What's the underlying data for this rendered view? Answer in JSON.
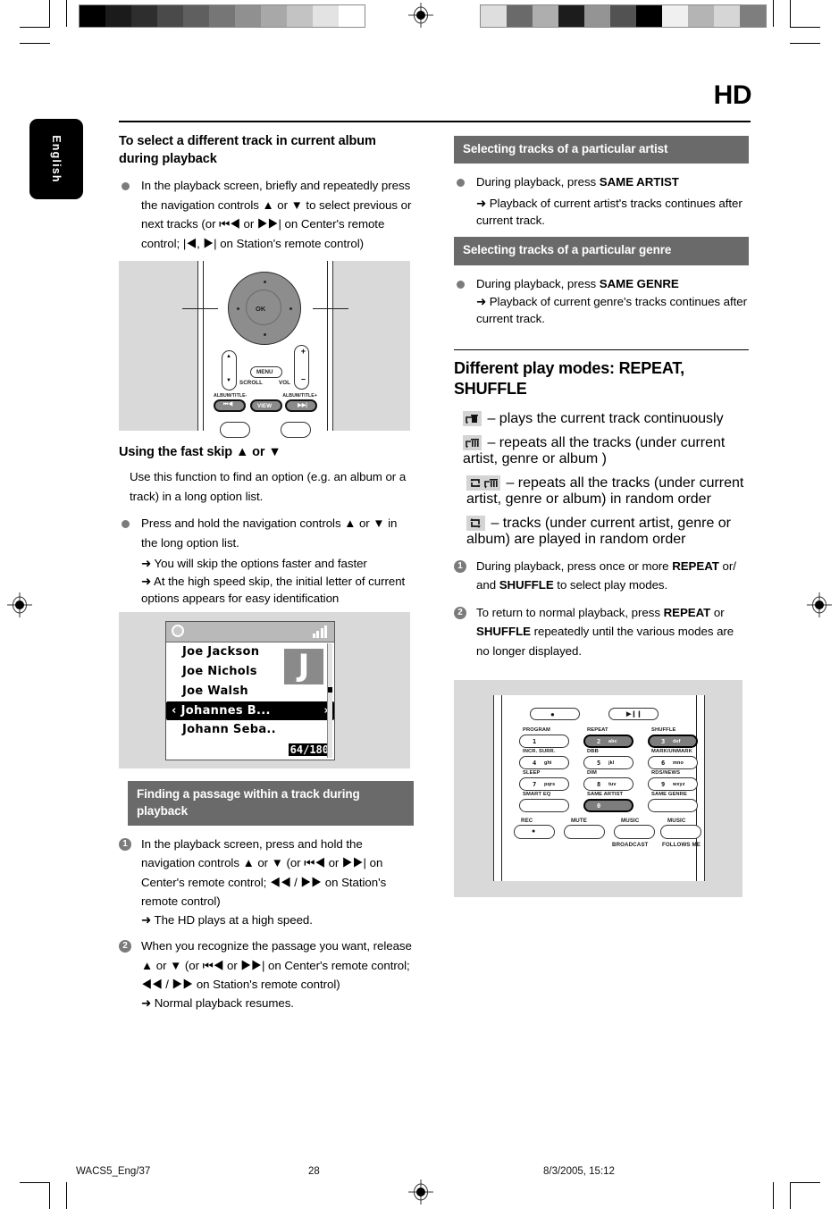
{
  "page": {
    "section_title": "HD",
    "language_tab": "English",
    "footer": {
      "file": "WACS5_Eng/37",
      "page_number": "28",
      "timestamp": "8/3/2005, 15:12"
    }
  },
  "calibration": {
    "left_strip": [
      "#000000",
      "#1b1b1b",
      "#2e2e2e",
      "#4a4a4a",
      "#5f5f5f",
      "#767676",
      "#909090",
      "#a8a8a8",
      "#c3c3c3",
      "#e3e3e3",
      "#ffffff"
    ],
    "right_strip": [
      "#dedede",
      "#6a6a6a",
      "#aeaeae",
      "#1c1c1c",
      "#949494",
      "#525252",
      "#000000",
      "#f0f0f0",
      "#b4b4b4",
      "#d6d6d6",
      "#7e7e7e"
    ]
  },
  "left_column": {
    "heading": "To select a different track in current album during playback",
    "bullet_1": "In the playback screen, briefly and repeatedly press the navigation controls ▲ or ▼ to select previous or next tracks (or ⏮◀ or ▶▶| on Center's remote control; |◀, ▶| on Station's remote control)",
    "figure_remote_1": {
      "name": "center-remote-navigation",
      "ok_label": "OK",
      "menu_label": "MENU",
      "view_label": "VIEW",
      "scroll_label": "SCROLL",
      "vol_label": "VOL",
      "vol_plus": "+",
      "vol_minus": "–",
      "album_prev": "ALBUM/TITLE-",
      "album_next": "ALBUM/TITLE+"
    },
    "fast_skip_heading": "Using the fast skip ▲ or ▼",
    "fast_skip_body": "Use this function to find an option (e.g. an album or a track) in a long option list.",
    "bullet_2": "Press and hold the navigation controls ▲ or ▼ in the long option list.",
    "bullet_2_arrow_1": "➜ You will skip the options faster and faster",
    "bullet_2_arrow_2": "➜  At the high speed skip, the initial letter of current options appears for easy identification",
    "figure_lcd": {
      "name": "artist-list-screen",
      "items": [
        "Joe  Jackson",
        "Joe Nichols",
        "Joe Walsh",
        "Johannes B...",
        "Johann Seba.."
      ],
      "selected_index": 3,
      "selected_left_arrow": "‹",
      "selected_right_arrow": "›",
      "initial_letter": "J",
      "counter": "64/180"
    },
    "bar_heading": "Finding a passage within a track during playback",
    "step_1": {
      "number": "1",
      "text": "In the playback screen, press and hold the navigation controls ▲ or ▼ (or ⏮◀ or ▶▶| on Center's remote control; ◀◀ / ▶▶ on Station's remote control)",
      "arrow": "➜ The HD plays at a high speed."
    },
    "step_2": {
      "number": "2",
      "text": "When you recognize the passage you want, release ▲ or ▼ (or ⏮◀ or ▶▶| on Center's remote control; ◀◀ / ▶▶ on Station's remote control)",
      "arrow": "➜ Normal playback resumes."
    }
  },
  "right_column": {
    "bar_heading_artist": "Selecting tracks of a particular artist",
    "artist_bullet": "During playback, press ",
    "artist_bullet_bold": "SAME ARTIST",
    "artist_arrow": "➜ Playback of current artist's tracks continues after current track.",
    "bar_heading_genre": "Selecting tracks of a particular genre",
    "genre_bullet": "During playback, press ",
    "genre_bullet_bold": "SAME GENRE",
    "genre_arrow": "➜ Playback of current genre's tracks continues after current track.",
    "play_modes_heading": "Different play modes: REPEAT, SHUFFLE",
    "modes": [
      {
        "icon": "repeat-one-icon",
        "text": "– plays the current track continuously"
      },
      {
        "icon": "repeat-all-icon",
        "text": "– repeats all the tracks (under current artist, genre or album )"
      },
      {
        "icon": "shuffle-repeat-all-icon",
        "text": "– repeats all the tracks (under current artist, genre or album) in random order"
      },
      {
        "icon": "shuffle-icon",
        "text": "– tracks (under current artist, genre or album) are played in random order"
      }
    ],
    "step_1": {
      "number": "1",
      "text_a": "During playback, press once or more ",
      "bold_a": "REPEAT",
      "text_b": " or/ and ",
      "bold_b": "SHUFFLE",
      "text_c": " to select play modes."
    },
    "step_2": {
      "number": "2",
      "text_a": "To return to normal playback, press ",
      "bold_a": "REPEAT",
      "text_b": " or ",
      "bold_b": "SHUFFLE",
      "text_c": " repeatedly until the various modes are no longer displayed."
    },
    "figure_remote_2": {
      "name": "station-remote-keypad",
      "buttons": [
        {
          "label": "PROGRAM",
          "key": "1",
          "letters": "",
          "highlight": false
        },
        {
          "label": "REPEAT",
          "key": "2",
          "letters": "abc",
          "highlight": true
        },
        {
          "label": "SHUFFLE",
          "key": "3",
          "letters": "def",
          "highlight": true
        },
        {
          "label": "INCR. SURR.",
          "key": "4",
          "letters": "ghi",
          "highlight": false
        },
        {
          "label": "DBB",
          "key": "5",
          "letters": "jkl",
          "highlight": false
        },
        {
          "label": "MARK/UNMARK",
          "key": "6",
          "letters": "mno",
          "highlight": false
        },
        {
          "label": "SLEEP",
          "key": "7",
          "letters": "pqrs",
          "highlight": false
        },
        {
          "label": "DIM",
          "key": "8",
          "letters": "tuv",
          "highlight": false
        },
        {
          "label": "RDS/NEWS",
          "key": "9",
          "letters": "wxyz",
          "highlight": false
        },
        {
          "label": "SMART EQ",
          "key": "",
          "letters": "",
          "highlight": false
        },
        {
          "label": "SAME ARTIST",
          "key": "0",
          "letters": "",
          "highlight": true
        },
        {
          "label": "SAME GENRE",
          "key": "",
          "letters": "",
          "highlight": false
        }
      ],
      "bottom_row": [
        "REC",
        "MUTE",
        "MUSIC",
        "MUSIC"
      ],
      "bottom_sub": [
        "BROADCAST",
        "FOLLOWS ME"
      ],
      "top_left_icon": "record-icon",
      "top_right_icon": "play-pause-icon"
    }
  }
}
